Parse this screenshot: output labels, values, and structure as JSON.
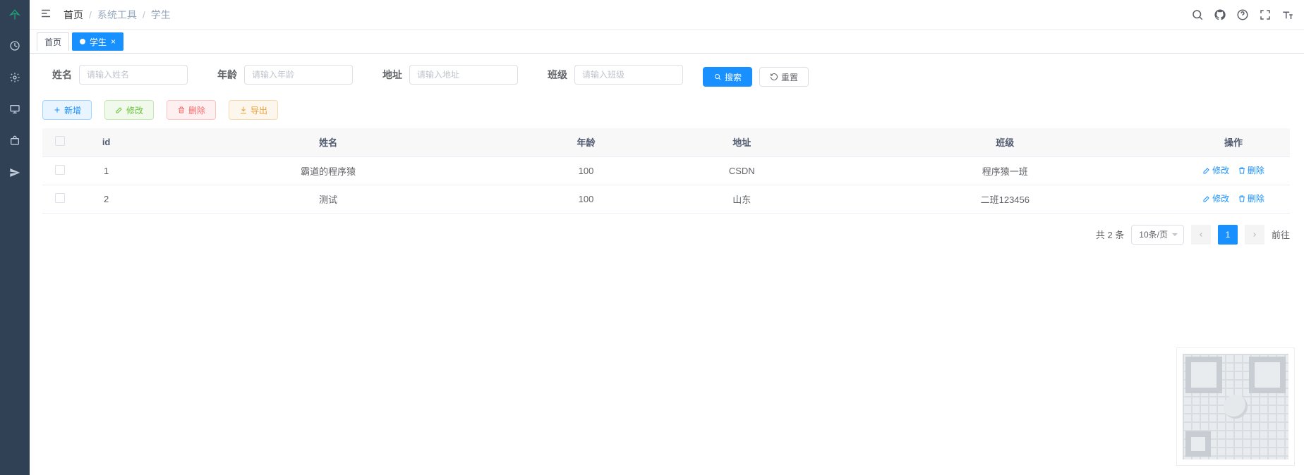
{
  "breadcrumb": {
    "home": "首页",
    "mid": "系统工具",
    "last": "学生"
  },
  "tabs": {
    "home": "首页",
    "active": "学生"
  },
  "filters": {
    "name_label": "姓名",
    "name_ph": "请输入姓名",
    "age_label": "年龄",
    "age_ph": "请输入年龄",
    "addr_label": "地址",
    "addr_ph": "请输入地址",
    "class_label": "班级",
    "class_ph": "请输入班级",
    "search": "搜索",
    "reset": "重置"
  },
  "actions": {
    "add": "新增",
    "edit": "修改",
    "del": "删除",
    "export": "导出"
  },
  "table": {
    "headers": {
      "id": "id",
      "name": "姓名",
      "age": "年龄",
      "addr": "地址",
      "class": "班级",
      "ops": "操作"
    },
    "rows": [
      {
        "id": "1",
        "name": "霸道的程序猿",
        "age": "100",
        "addr": "CSDN",
        "class": "程序猿一班"
      },
      {
        "id": "2",
        "name": "测试",
        "age": "100",
        "addr": "山东",
        "class": "二班123456"
      }
    ],
    "row_ops": {
      "edit": "修改",
      "del": "删除"
    }
  },
  "pagination": {
    "total": "共 2 条",
    "per_page": "10条/页",
    "page": "1",
    "goto": "前往"
  }
}
